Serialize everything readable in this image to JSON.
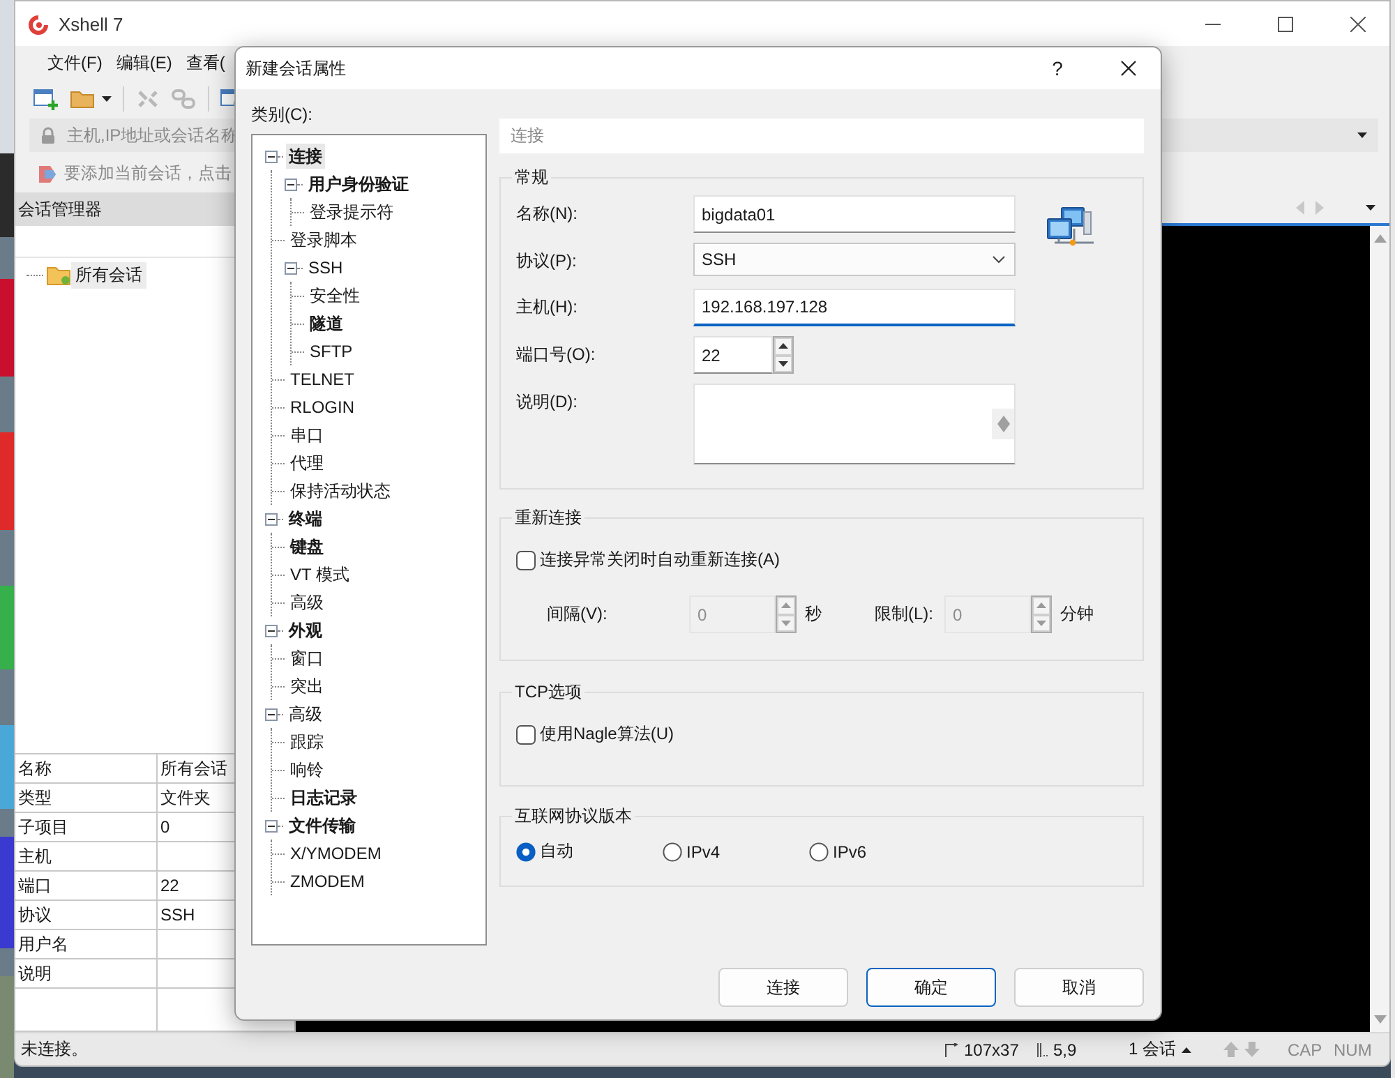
{
  "app": {
    "title": "Xshell 7",
    "menu": [
      "文件(F)",
      "编辑(E)",
      "查看("
    ],
    "address_placeholder": "主机,IP地址或会话名称",
    "hint": "要添加当前会话，点击"
  },
  "session_manager": {
    "title": "会话管理器",
    "tree": [
      {
        "label": "所有会话",
        "selected": true
      }
    ],
    "properties": [
      {
        "name": "名称",
        "value": "所有会话"
      },
      {
        "name": "类型",
        "value": "文件夹"
      },
      {
        "name": "子项目",
        "value": "0"
      },
      {
        "name": "主机"
      },
      {
        "name": "端口",
        "value": "22"
      },
      {
        "name": "协议",
        "value": "SSH"
      },
      {
        "name": "用户名"
      },
      {
        "name": "说明"
      }
    ]
  },
  "status_bar": {
    "text": "未连接。",
    "size": "107x37",
    "cursor": "5,9",
    "sessions": "1 会话",
    "caps": "CAP",
    "num": "NUM"
  },
  "dialog": {
    "title": "新建会话属性",
    "help": "?",
    "category_label": "类别(C):",
    "tree": [
      {
        "label": "连接",
        "modified": true,
        "selected": true,
        "expanded": true,
        "children": [
          {
            "label": "用户身份验证",
            "modified": true,
            "selected": false,
            "expanded": true,
            "children": [
              {
                "label": "登录提示符",
                "modified": false,
                "selected": false
              }
            ]
          },
          {
            "label": "登录脚本",
            "modified": false,
            "selected": false
          },
          {
            "label": "SSH",
            "modified": false,
            "selected": false,
            "expanded": true,
            "children": [
              {
                "label": "安全性",
                "modified": false,
                "selected": false
              },
              {
                "label": "隧道",
                "modified": true,
                "selected": false
              },
              {
                "label": "SFTP",
                "modified": false,
                "selected": false
              }
            ]
          },
          {
            "label": "TELNET",
            "modified": false,
            "selected": false
          },
          {
            "label": "RLOGIN",
            "modified": false,
            "selected": false
          },
          {
            "label": "串口",
            "modified": false,
            "selected": false
          },
          {
            "label": "代理",
            "modified": false,
            "selected": false
          },
          {
            "label": "保持活动状态",
            "modified": false,
            "selected": false
          }
        ]
      },
      {
        "label": "终端",
        "modified": true,
        "selected": false,
        "expanded": true,
        "children": [
          {
            "label": "键盘",
            "modified": true,
            "selected": false
          },
          {
            "label": "VT 模式",
            "modified": false,
            "selected": false
          },
          {
            "label": "高级",
            "modified": false,
            "selected": false
          }
        ]
      },
      {
        "label": "外观",
        "modified": true,
        "selected": false,
        "expanded": true,
        "children": [
          {
            "label": "窗口",
            "modified": false,
            "selected": false
          },
          {
            "label": "突出",
            "modified": false,
            "selected": false
          }
        ]
      },
      {
        "label": "高级",
        "modified": false,
        "selected": false,
        "expanded": true,
        "children": [
          {
            "label": "跟踪",
            "modified": false,
            "selected": false
          },
          {
            "label": "响铃",
            "modified": false,
            "selected": false
          },
          {
            "label": "日志记录",
            "modified": true,
            "selected": false
          }
        ]
      },
      {
        "label": "文件传输",
        "modified": true,
        "selected": false,
        "expanded": true,
        "children": [
          {
            "label": "X/YMODEM",
            "modified": false,
            "selected": false
          },
          {
            "label": "ZMODEM",
            "modified": false,
            "selected": false
          }
        ]
      }
    ],
    "page_title": "连接",
    "general": {
      "title": "常规",
      "fields": [
        {
          "kind": "text",
          "label": "名称(N):",
          "value": "bigdata01",
          "focused": false
        },
        {
          "kind": "select",
          "label": "协议(P):",
          "value": "SSH",
          "focused": false
        },
        {
          "kind": "text",
          "label": "主机(H):",
          "value": "192.168.197.128",
          "focused": true
        },
        {
          "kind": "spin",
          "label": "端口号(O):",
          "value": "22",
          "focused": false
        },
        {
          "kind": "textarea",
          "label": "说明(D):",
          "focused": false
        }
      ]
    },
    "reconnect": {
      "title": "重新连接",
      "checkbox": {
        "label": "连接异常关闭时自动重新连接(A)",
        "checked": false
      },
      "spins": [
        {
          "label": "间隔(V):",
          "value": "0",
          "unit": "秒",
          "disabled": true
        },
        {
          "label": "限制(L):",
          "value": "0",
          "unit": "分钟",
          "disabled": true
        }
      ]
    },
    "tcp": {
      "title": "TCP选项",
      "checkbox": {
        "label": "使用Nagle算法(U)",
        "checked": false
      }
    },
    "ip_version": {
      "title": "互联网协议版本",
      "options": [
        {
          "label": "自动",
          "selected": true
        },
        {
          "label": "IPv4",
          "selected": false
        },
        {
          "label": "IPv6",
          "selected": false
        }
      ]
    },
    "buttons": [
      {
        "label": "连接",
        "default": false
      },
      {
        "label": "确定",
        "default": true
      },
      {
        "label": "取消",
        "default": false
      }
    ]
  }
}
